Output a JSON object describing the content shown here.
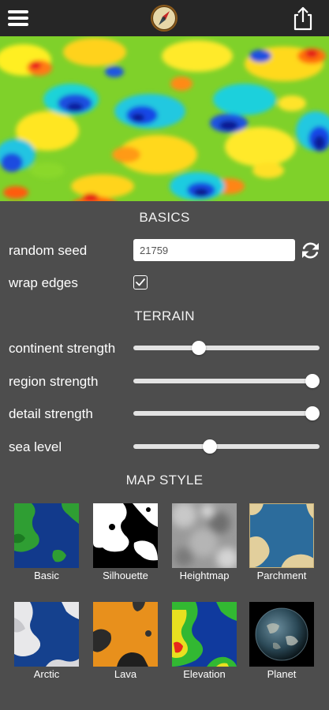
{
  "header": {
    "menu_icon": "hamburger-menu-icon",
    "logo_icon": "compass-icon",
    "share_icon": "share-icon"
  },
  "basics": {
    "title": "BASICS",
    "random_seed_label": "random seed",
    "random_seed_value": "21759",
    "refresh_icon": "refresh-icon",
    "wrap_edges_label": "wrap edges",
    "wrap_edges_checked": true
  },
  "terrain": {
    "title": "TERRAIN",
    "sliders": [
      {
        "label": "continent strength",
        "value": 0.35
      },
      {
        "label": "region strength",
        "value": 0.96
      },
      {
        "label": "detail strength",
        "value": 0.96
      },
      {
        "label": "sea level",
        "value": 0.41
      }
    ]
  },
  "map_style": {
    "title": "MAP STYLE",
    "styles": [
      {
        "label": "Basic"
      },
      {
        "label": "Silhouette"
      },
      {
        "label": "Heightmap"
      },
      {
        "label": "Parchment"
      },
      {
        "label": "Arctic"
      },
      {
        "label": "Lava"
      },
      {
        "label": "Elevation"
      },
      {
        "label": "Planet"
      }
    ]
  },
  "colors": {
    "topbar": "#262626",
    "panel": "#4d4d4d",
    "text": "#ffffff"
  }
}
